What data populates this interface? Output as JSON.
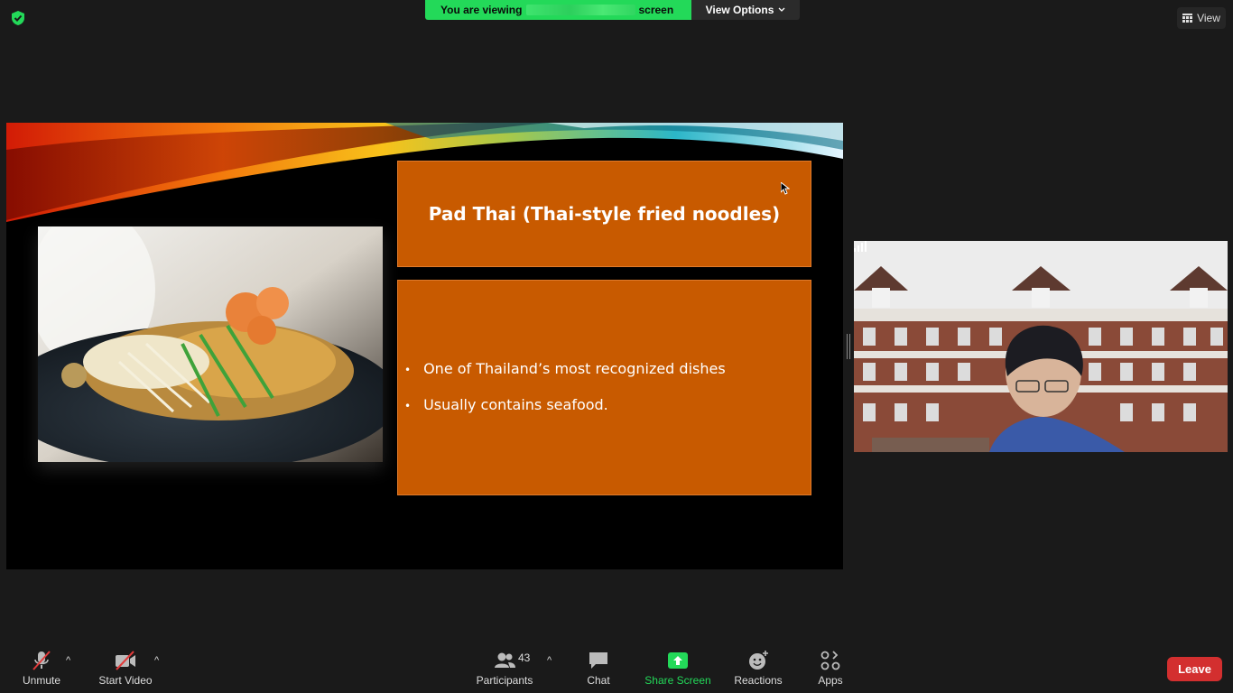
{
  "top_bar": {
    "viewing_prefix": "You are viewing",
    "viewing_suffix": "screen",
    "view_options_label": "View Options",
    "view_label": "View"
  },
  "slide": {
    "title": "Pad Thai (Thai-style fried noodles)",
    "bullets": [
      "One of Thailand’s most recognized dishes",
      "Usually contains seafood."
    ],
    "box_color": "#c85a00"
  },
  "toolbar": {
    "unmute_label": "Unmute",
    "start_video_label": "Start Video",
    "participants_label": "Participants",
    "participants_count": "43",
    "chat_label": "Chat",
    "share_screen_label": "Share Screen",
    "reactions_label": "Reactions",
    "apps_label": "Apps",
    "leave_label": "Leave",
    "accent_green": "#23d959",
    "leave_red": "#d32f2f"
  }
}
